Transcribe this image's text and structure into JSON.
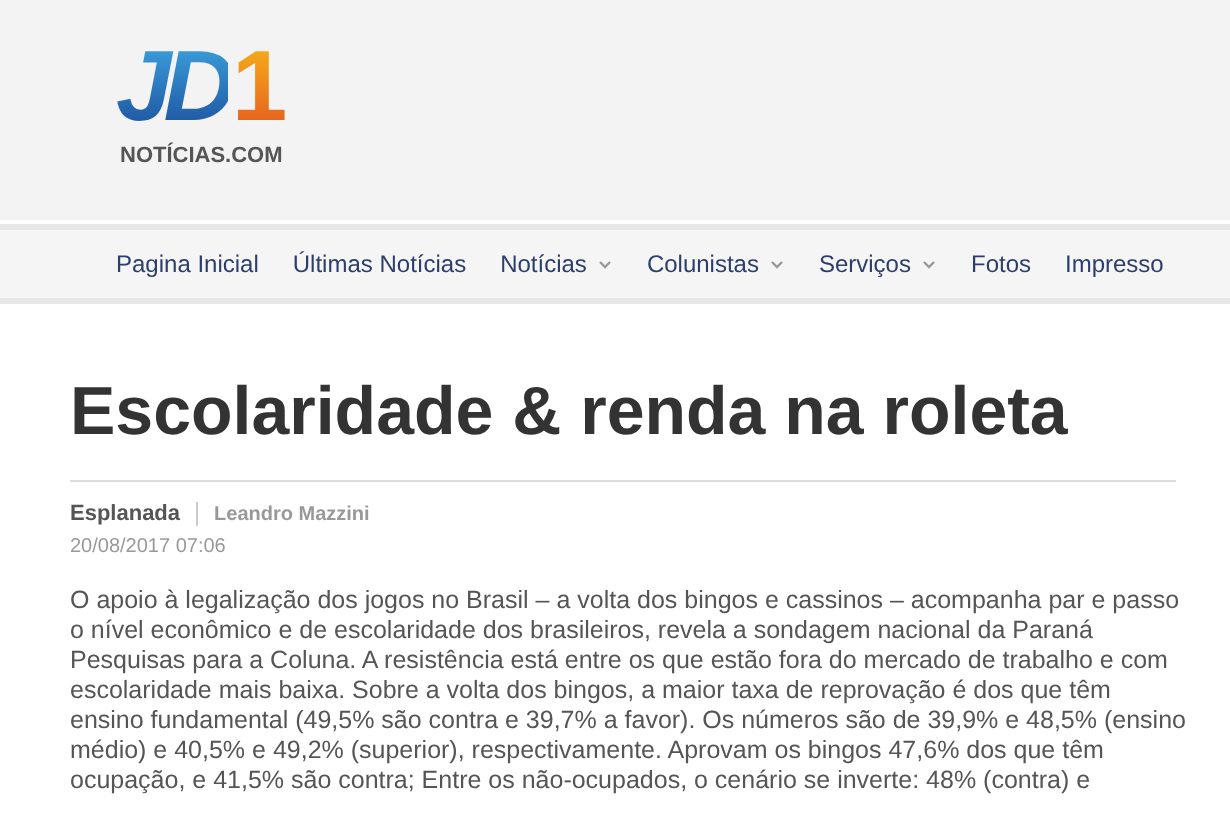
{
  "logo": {
    "mark": "JD",
    "digit": "1",
    "domain": "NOTÍCIAS.COM"
  },
  "nav": [
    {
      "label": "Pagina Inicial",
      "dropdown": false
    },
    {
      "label": "Últimas Notícias",
      "dropdown": false
    },
    {
      "label": "Notícias",
      "dropdown": true
    },
    {
      "label": "Colunistas",
      "dropdown": true
    },
    {
      "label": "Serviços",
      "dropdown": true
    },
    {
      "label": "Fotos",
      "dropdown": false
    },
    {
      "label": "Impresso",
      "dropdown": false
    }
  ],
  "article": {
    "title": "Escolaridade & renda na roleta",
    "section": "Esplanada",
    "author": "Leandro Mazzini",
    "date": "20/08/2017 07:06",
    "body": "O apoio à legalização dos jogos no Brasil – a volta dos bingos e cassinos – acompanha par e passo o nível econômico e de escolaridade dos brasileiros, revela a sondagem nacional da Paraná Pesquisas para a Coluna. A resistência está entre os que estão fora do mercado de trabalho e com escolaridade mais baixa. Sobre a volta dos bingos, a maior taxa de reprovação é dos que têm ensino fundamental (49,5% são contra e 39,7% a favor). Os números são de 39,9% e 48,5% (ensino médio) e 40,5% e 49,2% (superior), respectivamente. Aprovam os bingos 47,6% dos que têm ocupação, e 41,5% são contra; Entre os não-ocupados, o cenário se inverte: 48% (contra) e"
  }
}
